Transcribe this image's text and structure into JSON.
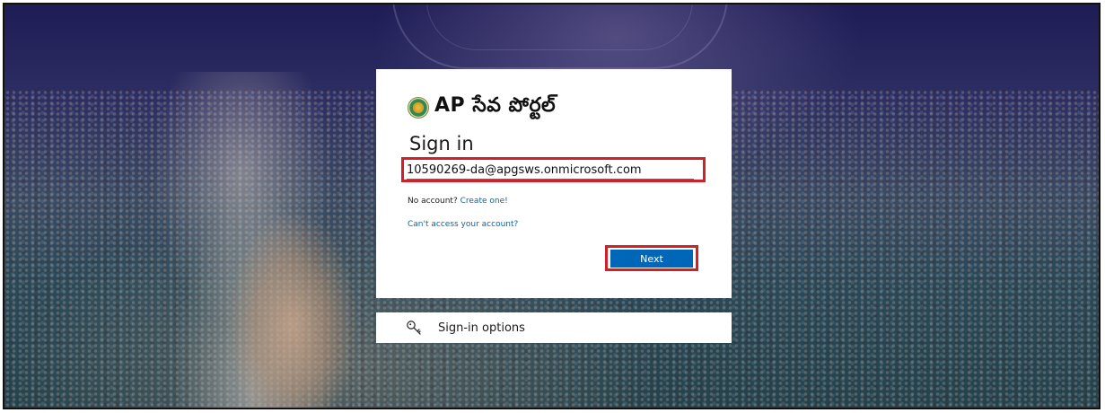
{
  "brand": {
    "portal_name": "AP సేవ పోర్టల్"
  },
  "login": {
    "title": "Sign in",
    "email_value": "10590269-da@apgsws.onmicrosoft.com",
    "no_account_text": "No account?",
    "create_link": "Create one!",
    "cant_access_link": "Can't access your account?",
    "next_label": "Next"
  },
  "options": {
    "label": "Sign-in options",
    "icon": "key-icon"
  },
  "colors": {
    "accent": "#0067b8",
    "highlight": "#d0212a"
  }
}
